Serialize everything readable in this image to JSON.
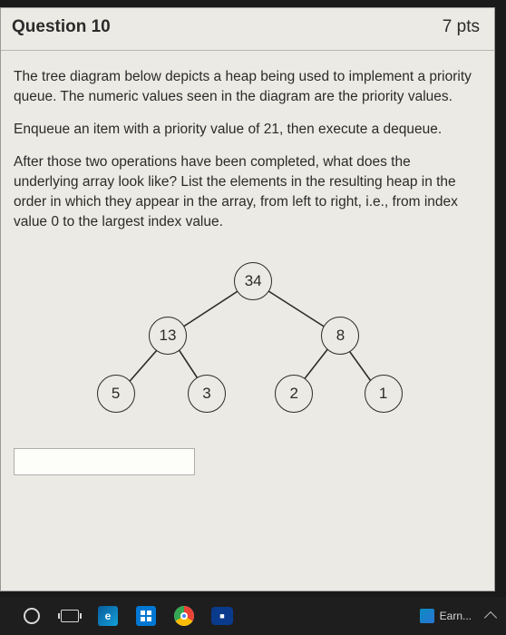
{
  "question": {
    "title": "Question 10",
    "points": "7 pts",
    "paragraphs": [
      "The tree diagram below depicts a heap being used to implement a priority queue. The numeric values seen in the diagram are the priority values.",
      "Enqueue an item with a priority value of 21, then execute a dequeue.",
      "After those two operations have been completed, what does the underlying array look like? List the elements in the resulting heap in the order in which they appear in the array, from left to right, i.e., from index value 0 to the largest index value."
    ],
    "answer_value": ""
  },
  "tree": {
    "nodes": {
      "root": "34",
      "l": "13",
      "r": "8",
      "ll": "5",
      "lr": "3",
      "rl": "2",
      "rr": "1"
    }
  },
  "taskbar": {
    "earn_label": "Earn..."
  }
}
